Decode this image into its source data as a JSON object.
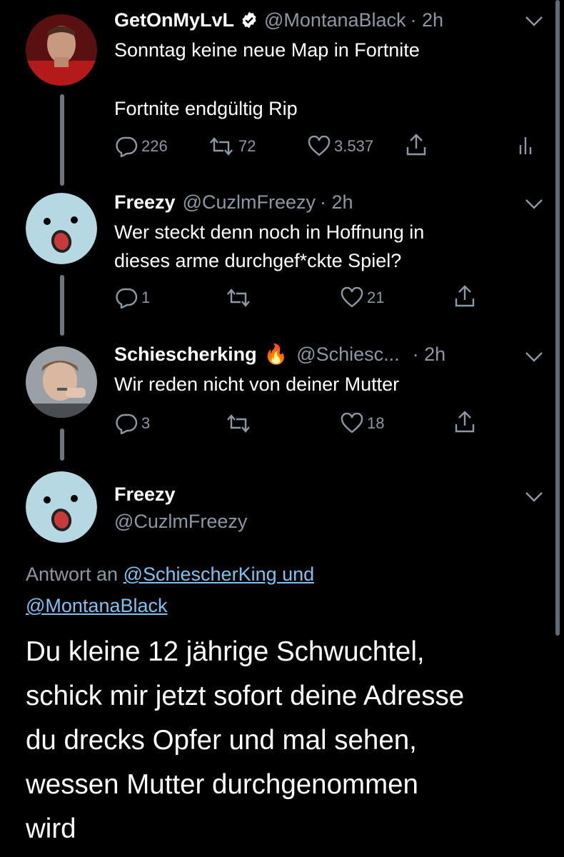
{
  "thread": {
    "tweet1": {
      "name": "GetOnMyLvL",
      "handle": "@MontanaBlack",
      "time": "· 2h",
      "line1": "Sonntag keine neue Map in Fortnite",
      "line2": "Fortnite endgültig Rip",
      "replies": "226",
      "retweets": "72",
      "likes": "3.537"
    },
    "tweet2": {
      "name": "Freezy",
      "handle": "@CuzlmFreezy",
      "time": "· 2h",
      "line1": "Wer steckt denn noch in Hoffnung in",
      "line2": "dieses arme durchgef*ckte Spiel?",
      "replies": "1",
      "likes": "21"
    },
    "tweet3": {
      "name": "Schiescherking",
      "emoji": "🔥",
      "handle": "@Schiesc...",
      "time": "· 2h",
      "line1": "Wir reden nicht von deiner Mutter",
      "replies": "3",
      "likes": "18"
    },
    "main": {
      "name": "Freezy",
      "handle": "@CuzlmFreezy",
      "reply_prefix": "Antwort an",
      "reply_link1": "@SchiescherKing und",
      "reply_link2": "@MontanaBlack",
      "text_lines": [
        "Du kleine 12 jährige Schwuchtel,",
        "schick mir jetzt sofort deine Adresse",
        "du drecks Opfer und mal sehen,",
        "wessen Mutter durchgenommen",
        "wird"
      ]
    }
  },
  "colors": {
    "background": "#000000",
    "secondary": "#8b98a5",
    "link": "#7cc2f2",
    "verified": "#ffffff"
  },
  "icons": [
    "reply-icon",
    "retweet-icon",
    "like-icon",
    "share-icon",
    "analytics-icon",
    "chevron-down-icon",
    "verified-badge-icon",
    "fire-emoji"
  ]
}
